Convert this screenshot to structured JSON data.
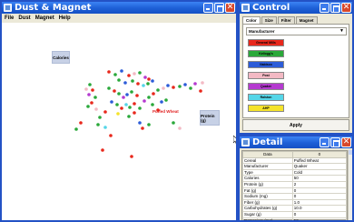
{
  "main_window": {
    "title": "Dust & Magnet",
    "menu": [
      "File",
      "Dust",
      "Magnet",
      "Help"
    ],
    "magnets": [
      {
        "label": "Calories"
      },
      {
        "label": "Protein (g)"
      }
    ],
    "highlighted_dust_label": "Puffed Wheat"
  },
  "control_window": {
    "title": "Control",
    "tabs": [
      "Color",
      "Size",
      "Filter",
      "Magnet"
    ],
    "selected_attribute": "Manufacturer",
    "manufacturers": [
      {
        "label": "General Mills",
        "color": "#e8281c"
      },
      {
        "label": "Kellogg's",
        "color": "#2aa83a"
      },
      {
        "label": "Nabisco",
        "color": "#2c5cd8"
      },
      {
        "label": "Post",
        "color": "#f3b9c4"
      },
      {
        "label": "Quaker",
        "color": "#b53ad0"
      },
      {
        "label": "Ralston",
        "color": "#55d6e8"
      },
      {
        "label": "AHP",
        "color": "#f5e32a"
      }
    ],
    "apply_label": "Apply"
  },
  "detail_window": {
    "title": "Detail",
    "columns": [
      "Data",
      "0"
    ],
    "rows": [
      [
        "Cereal",
        "Puffed Wheat"
      ],
      [
        "Manufacturer",
        "Quaker"
      ],
      [
        "Type",
        "Cold"
      ],
      [
        "Calories",
        "50"
      ],
      [
        "Protein (g)",
        "2"
      ],
      [
        "Fat (g)",
        "0"
      ],
      [
        "Sodium (mg)",
        "0"
      ],
      [
        "Fiber (g)",
        "1.0"
      ],
      [
        "Carbohydrates (g)",
        "10.0"
      ],
      [
        "Sugar (g)",
        "0"
      ],
      [
        "Potassium (mg)",
        "50"
      ]
    ]
  }
}
